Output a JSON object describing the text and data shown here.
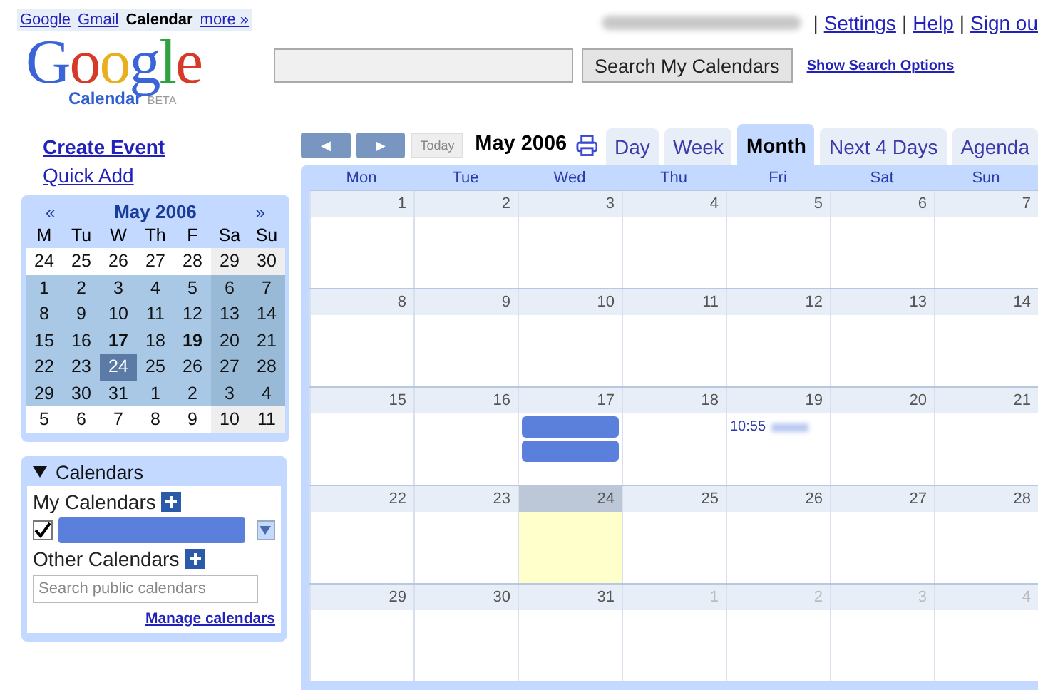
{
  "top_links": [
    {
      "label": "Google",
      "selected": false
    },
    {
      "label": "Gmail",
      "selected": false
    },
    {
      "label": "Calendar",
      "selected": true
    },
    {
      "label": "more »",
      "selected": false
    }
  ],
  "account_links": [
    {
      "separator": "|",
      "label": "Settings"
    },
    {
      "separator": "|",
      "label": "Help"
    },
    {
      "separator": "|",
      "label": "Sign ou"
    }
  ],
  "logo": {
    "wordmark": "Google",
    "product": "Calendar",
    "badge": "BETA"
  },
  "search": {
    "button": "Search My Calendars",
    "options_link": "Show Search Options"
  },
  "sidebar": {
    "create_event": "Create Event",
    "quick_add": "Quick Add"
  },
  "mini_calendar": {
    "title": "May 2006",
    "prev": "«",
    "next": "»",
    "weekdays": [
      "M",
      "Tu",
      "W",
      "Th",
      "F",
      "Sa",
      "Su"
    ],
    "weeks": [
      [
        {
          "label": "24",
          "in_month": false,
          "bold": false,
          "selected": false
        },
        {
          "label": "25",
          "in_month": false,
          "bold": false,
          "selected": false
        },
        {
          "label": "26",
          "in_month": false,
          "bold": false,
          "selected": false
        },
        {
          "label": "27",
          "in_month": false,
          "bold": false,
          "selected": false
        },
        {
          "label": "28",
          "in_month": false,
          "bold": false,
          "selected": false
        },
        {
          "label": "29",
          "in_month": false,
          "bold": false,
          "selected": false
        },
        {
          "label": "30",
          "in_month": false,
          "bold": false,
          "selected": false
        }
      ],
      [
        {
          "label": "1",
          "in_month": true,
          "bold": false,
          "selected": false
        },
        {
          "label": "2",
          "in_month": true,
          "bold": false,
          "selected": false
        },
        {
          "label": "3",
          "in_month": true,
          "bold": false,
          "selected": false
        },
        {
          "label": "4",
          "in_month": true,
          "bold": false,
          "selected": false
        },
        {
          "label": "5",
          "in_month": true,
          "bold": false,
          "selected": false
        },
        {
          "label": "6",
          "in_month": true,
          "bold": false,
          "selected": false
        },
        {
          "label": "7",
          "in_month": true,
          "bold": false,
          "selected": false
        }
      ],
      [
        {
          "label": "8",
          "in_month": true,
          "bold": false,
          "selected": false
        },
        {
          "label": "9",
          "in_month": true,
          "bold": false,
          "selected": false
        },
        {
          "label": "10",
          "in_month": true,
          "bold": false,
          "selected": false
        },
        {
          "label": "11",
          "in_month": true,
          "bold": false,
          "selected": false
        },
        {
          "label": "12",
          "in_month": true,
          "bold": false,
          "selected": false
        },
        {
          "label": "13",
          "in_month": true,
          "bold": false,
          "selected": false
        },
        {
          "label": "14",
          "in_month": true,
          "bold": false,
          "selected": false
        }
      ],
      [
        {
          "label": "15",
          "in_month": true,
          "bold": false,
          "selected": false
        },
        {
          "label": "16",
          "in_month": true,
          "bold": false,
          "selected": false
        },
        {
          "label": "17",
          "in_month": true,
          "bold": true,
          "selected": false
        },
        {
          "label": "18",
          "in_month": true,
          "bold": false,
          "selected": false
        },
        {
          "label": "19",
          "in_month": true,
          "bold": true,
          "selected": false
        },
        {
          "label": "20",
          "in_month": true,
          "bold": false,
          "selected": false
        },
        {
          "label": "21",
          "in_month": true,
          "bold": false,
          "selected": false
        }
      ],
      [
        {
          "label": "22",
          "in_month": true,
          "bold": false,
          "selected": false
        },
        {
          "label": "23",
          "in_month": true,
          "bold": false,
          "selected": false
        },
        {
          "label": "24",
          "in_month": true,
          "bold": false,
          "selected": true
        },
        {
          "label": "25",
          "in_month": true,
          "bold": false,
          "selected": false
        },
        {
          "label": "26",
          "in_month": true,
          "bold": false,
          "selected": false
        },
        {
          "label": "27",
          "in_month": true,
          "bold": false,
          "selected": false
        },
        {
          "label": "28",
          "in_month": true,
          "bold": false,
          "selected": false
        }
      ],
      [
        {
          "label": "29",
          "in_month": true,
          "bold": false,
          "selected": false
        },
        {
          "label": "30",
          "in_month": true,
          "bold": false,
          "selected": false
        },
        {
          "label": "31",
          "in_month": true,
          "bold": false,
          "selected": false
        },
        {
          "label": "1",
          "in_month": true,
          "bold": false,
          "selected": false
        },
        {
          "label": "2",
          "in_month": true,
          "bold": false,
          "selected": false
        },
        {
          "label": "3",
          "in_month": true,
          "bold": false,
          "selected": false
        },
        {
          "label": "4",
          "in_month": true,
          "bold": false,
          "selected": false
        }
      ],
      [
        {
          "label": "5",
          "in_month": false,
          "bold": false,
          "selected": false
        },
        {
          "label": "6",
          "in_month": false,
          "bold": false,
          "selected": false
        },
        {
          "label": "7",
          "in_month": false,
          "bold": false,
          "selected": false
        },
        {
          "label": "8",
          "in_month": false,
          "bold": false,
          "selected": false
        },
        {
          "label": "9",
          "in_month": false,
          "bold": false,
          "selected": false
        },
        {
          "label": "10",
          "in_month": false,
          "bold": false,
          "selected": false
        },
        {
          "label": "11",
          "in_month": false,
          "bold": false,
          "selected": false
        }
      ]
    ]
  },
  "calendars": {
    "title": "Calendars",
    "expanded": true,
    "my_label": "My Calendars",
    "my_calendars": [
      {
        "checked": true,
        "color": "#5b80dc"
      }
    ],
    "other_label": "Other Calendars",
    "search_placeholder": "Search public calendars",
    "manage_link": "Manage calendars"
  },
  "toolbar": {
    "prev": "◀",
    "next": "▶",
    "today": "Today",
    "today_disabled": true,
    "period": "May 2006"
  },
  "view_tabs": [
    {
      "label": "Day",
      "selected": false
    },
    {
      "label": "Week",
      "selected": false
    },
    {
      "label": "Month",
      "selected": true
    },
    {
      "label": "Next 4 Days",
      "selected": false
    },
    {
      "label": "Agenda",
      "selected": false
    }
  ],
  "month": {
    "weekdays": [
      "Mon",
      "Tue",
      "Wed",
      "Thu",
      "Fri",
      "Sat",
      "Sun"
    ],
    "weeks": [
      [
        {
          "label": "1",
          "in_month": true,
          "today": false
        },
        {
          "label": "2",
          "in_month": true,
          "today": false
        },
        {
          "label": "3",
          "in_month": true,
          "today": false
        },
        {
          "label": "4",
          "in_month": true,
          "today": false
        },
        {
          "label": "5",
          "in_month": true,
          "today": false
        },
        {
          "label": "6",
          "in_month": true,
          "today": false
        },
        {
          "label": "7",
          "in_month": true,
          "today": false
        }
      ],
      [
        {
          "label": "8",
          "in_month": true,
          "today": false
        },
        {
          "label": "9",
          "in_month": true,
          "today": false
        },
        {
          "label": "10",
          "in_month": true,
          "today": false
        },
        {
          "label": "11",
          "in_month": true,
          "today": false
        },
        {
          "label": "12",
          "in_month": true,
          "today": false
        },
        {
          "label": "13",
          "in_month": true,
          "today": false
        },
        {
          "label": "14",
          "in_month": true,
          "today": false
        }
      ],
      [
        {
          "label": "15",
          "in_month": true,
          "today": false
        },
        {
          "label": "16",
          "in_month": true,
          "today": false
        },
        {
          "label": "17",
          "in_month": true,
          "today": false,
          "events": [
            {
              "kind": "allday"
            },
            {
              "kind": "allday"
            }
          ]
        },
        {
          "label": "18",
          "in_month": true,
          "today": false
        },
        {
          "label": "19",
          "in_month": true,
          "today": false,
          "events": [
            {
              "kind": "timed",
              "time": "10:55"
            }
          ]
        },
        {
          "label": "20",
          "in_month": true,
          "today": false
        },
        {
          "label": "21",
          "in_month": true,
          "today": false
        }
      ],
      [
        {
          "label": "22",
          "in_month": true,
          "today": false
        },
        {
          "label": "23",
          "in_month": true,
          "today": false
        },
        {
          "label": "24",
          "in_month": true,
          "today": true
        },
        {
          "label": "25",
          "in_month": true,
          "today": false
        },
        {
          "label": "26",
          "in_month": true,
          "today": false
        },
        {
          "label": "27",
          "in_month": true,
          "today": false
        },
        {
          "label": "28",
          "in_month": true,
          "today": false
        }
      ],
      [
        {
          "label": "29",
          "in_month": true,
          "today": false
        },
        {
          "label": "30",
          "in_month": true,
          "today": false
        },
        {
          "label": "31",
          "in_month": true,
          "today": false
        },
        {
          "label": "1",
          "in_month": false,
          "today": false
        },
        {
          "label": "2",
          "in_month": false,
          "today": false
        },
        {
          "label": "3",
          "in_month": false,
          "today": false
        },
        {
          "label": "4",
          "in_month": false,
          "today": false
        }
      ]
    ]
  }
}
